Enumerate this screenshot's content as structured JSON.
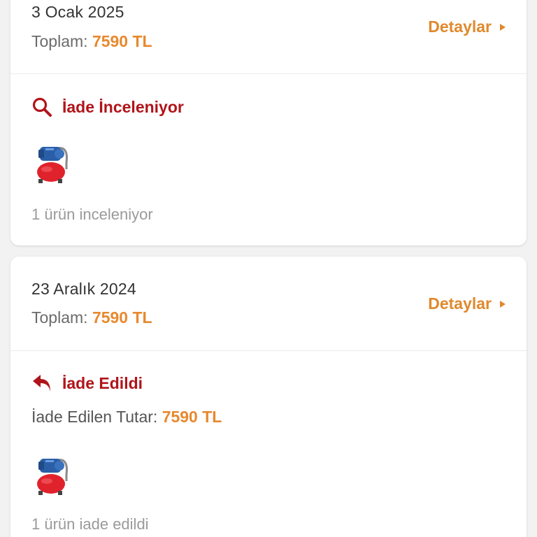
{
  "colors": {
    "accent_orange": "#e0892d",
    "status_red": "#b0141a",
    "background": "#f2f2f2",
    "card": "#ffffff"
  },
  "orders": [
    {
      "date": "3 Ocak 2025",
      "total_label": "Toplam:",
      "total_value": "7590 TL",
      "details_label": "Detaylar",
      "status_icon": "search-icon",
      "status_text": "İade İnceleniyor",
      "items_note": "1 ürün inceleniyor"
    },
    {
      "date": "23 Aralık 2024",
      "total_label": "Toplam:",
      "total_value": "7590 TL",
      "details_label": "Detaylar",
      "status_icon": "reply-arrow-icon",
      "status_text": "İade Edildi",
      "refund_label": "İade Edilen Tutar:",
      "refund_value": "7590 TL",
      "items_note": "1 ürün iade edildi"
    }
  ]
}
